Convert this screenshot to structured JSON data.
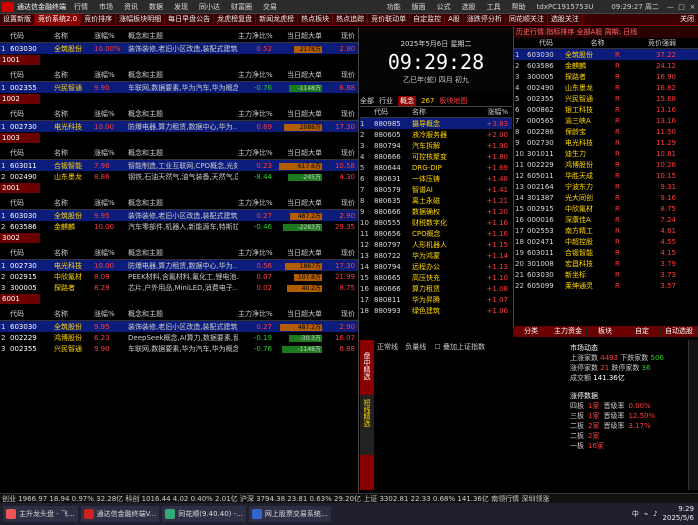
{
  "menubar": {
    "title": "通达信金融终端",
    "items": [
      "行情",
      "市场",
      "资讯",
      "数据",
      "发现",
      "同小达",
      "财富圈",
      "交易"
    ],
    "right_items": [
      "功能",
      "版面",
      "公式",
      "选股",
      "工具",
      "帮助"
    ],
    "account": "tdxPC1915753U",
    "clock": "09:29:27 周二"
  },
  "tabs": [
    "设置新版",
    "竞价系统2.0",
    "竞价排序",
    "涨幅板块明细",
    "每日早盘公告",
    "龙虎榜复盘",
    "新闻龙虎榜",
    "热点板块",
    "热点追踪",
    "竞价联动单",
    "自定监控",
    "A股",
    "涨跌停分析",
    "同花顺关注",
    "选股关注",
    "关闭"
  ],
  "headers": [
    "代码",
    "名称",
    "涨幅%",
    "概念和主题",
    "主力净比%",
    "当日超大单",
    "现价"
  ],
  "sections": [
    {
      "marker": "",
      "count": "",
      "rows": [
        [
          "1",
          "603030",
          "全筑股份",
          "10.00%",
          "装饰装修,老旧小区改造,装配式建筑,人工智能,物联网..",
          "0.52",
          "2178万",
          "2.90"
        ]
      ]
    },
    {
      "marker": "1001",
      "count": "",
      "rows": [
        [
          "1",
          "002355",
          "兴民智通",
          "9.90",
          "车联网,数据要素,华为汽车,华为概念..",
          "-0.76",
          "-1148万",
          "6.88"
        ]
      ]
    },
    {
      "marker": "1002",
      "count": "",
      "rows": [
        [
          "1",
          "002730",
          "电光科技",
          "10.00",
          "防爆电器,算力租赁,数据中心,华为..",
          "0.69",
          "2088万",
          "17.30"
        ]
      ]
    },
    {
      "marker": "1003",
      "count": "",
      "rows": [
        [
          "1",
          "603011",
          "合锻智能",
          "7.96",
          "智能制造,工业互联网,CPO概念,光刻机,工业母机",
          "0.23",
          "617.6万",
          "10.58"
        ],
        [
          "2",
          "002490",
          "山东墨龙",
          "8.86",
          "钢铁,石油天然气,油气装备,天然气,国企改革..",
          "-8.44",
          "-245万",
          "4.30"
        ]
      ]
    },
    {
      "marker": "2001",
      "count": "",
      "rows": [
        [
          "1",
          "603030",
          "全筑股份",
          "9.95",
          "装饰装修,老旧小区改造,装配式建筑,人工智能,物联网..",
          "0.27",
          "487.2万",
          "2.90"
        ],
        [
          "2",
          "603586",
          "金麒麟",
          "10.00",
          "汽车零部件,机器人,新能源车,特斯拉..",
          "-0.46",
          "-2283万",
          "29.35"
        ]
      ]
    },
    {
      "marker": "3002",
      "count": "3",
      "rows": [
        [
          "1",
          "002730",
          "电光科技",
          "10.00",
          "防爆电器,算力租赁,数据中心,华为..",
          "0.56",
          "1867万",
          "17.30"
        ],
        [
          "2",
          "002915",
          "中欣氟材",
          "8.09",
          "PEEK材料,含氟材料,氟化工,锂电池..",
          "0.07",
          "107.8万",
          "21.99"
        ],
        [
          "3",
          "300005",
          "探路者",
          "8.29",
          "芯片,户外用品,MiniLED,消费电子..",
          "0.02",
          "40.2万",
          "8.75"
        ]
      ]
    },
    {
      "marker": "6001",
      "count": "3",
      "rows": [
        [
          "1",
          "603030",
          "全筑股份",
          "9.95",
          "装饰装修,老旧小区改造,装配式建筑,人工智能,物联网..",
          "0.27",
          "487.2万",
          "2.90"
        ],
        [
          "2",
          "002229",
          "鸿博股份",
          "6.23",
          "DeepSeek概念,AI算力,数据要素,智能..",
          "-0.19",
          "-30.3万",
          "16.07"
        ],
        [
          "3",
          "002355",
          "兴民智通",
          "9.90",
          "车联网,数据要素,华为汽车,华为概念..",
          "-0.76",
          "-1148万",
          "6.88"
        ]
      ]
    }
  ],
  "clock": {
    "date": "2025年5月6日 星期二",
    "time": "09:29:28",
    "lunar": "乙巳年(蛇) 四月 初九"
  },
  "concept": {
    "tabs": [
      "全部",
      "行业",
      "概念",
      "267",
      "板块地图"
    ],
    "headers": [
      "代码",
      "名称",
      "涨幅%"
    ],
    "rows": [
      [
        "1",
        "880985",
        "摄导概念",
        "+3.83"
      ],
      [
        "2",
        "880605",
        "液冷服务器",
        "+2.00"
      ],
      [
        "3",
        "880794",
        "汽车拆解",
        "+1.90"
      ],
      [
        "4",
        "880666",
        "可控核聚变",
        "+1.80"
      ],
      [
        "5",
        "880644",
        "DRG-DIP",
        "+1.69"
      ],
      [
        "6",
        "880631",
        "一体压铸",
        "+1.48"
      ],
      [
        "7",
        "880579",
        "智谱AI",
        "+1.41"
      ],
      [
        "8",
        "880635",
        "离土永磁",
        "+1.21"
      ],
      [
        "9",
        "880666",
        "数据确权",
        "+1.20"
      ],
      [
        "10",
        "880555",
        "财税数字化",
        "+1.16"
      ],
      [
        "11",
        "880656",
        "CPO概念",
        "+1.16"
      ],
      [
        "12",
        "880797",
        "人形机器人",
        "+1.15"
      ],
      [
        "13",
        "880722",
        "华为鸿蒙",
        "+1.14"
      ],
      [
        "14",
        "880794",
        "远程办公",
        "+1.13"
      ],
      [
        "15",
        "880665",
        "高压快充",
        "+1.10"
      ],
      [
        "16",
        "880666",
        "算力租赁",
        "+1.08"
      ],
      [
        "17",
        "880811",
        "华为昇腾",
        "+1.07"
      ],
      [
        "18",
        "880993",
        "绿色建筑",
        "+1.06"
      ]
    ]
  },
  "right": {
    "title": "历史行情:指标排序 全部A股 周期: 日线",
    "headers": [
      "代码",
      "名称",
      "竞价强弱"
    ],
    "rows": [
      [
        "1",
        "603030",
        "全筑股份",
        "R",
        "37.22"
      ],
      [
        "2",
        "603586",
        "金麒麟",
        "R",
        "24.12"
      ],
      [
        "3",
        "300005",
        "探路者",
        "R",
        "16.90"
      ],
      [
        "4",
        "002490",
        "山东墨龙",
        "R",
        "16.82"
      ],
      [
        "5",
        "002355",
        "兴民智通",
        "R",
        "15.68"
      ],
      [
        "6",
        "000862",
        "银工科技",
        "R",
        "13.16"
      ],
      [
        "7",
        "000565",
        "渝三峡A",
        "R",
        "13.16"
      ],
      [
        "8",
        "002286",
        "保龄宝",
        "R",
        "11.50"
      ],
      [
        "9",
        "002730",
        "电光科技",
        "R",
        "11.29"
      ],
      [
        "10",
        "301011",
        "迪生力",
        "R",
        "10.81"
      ],
      [
        "11",
        "002229",
        "鸿博股份",
        "R",
        "10.26"
      ],
      [
        "12",
        "605011",
        "华胜天成",
        "R",
        "10.15"
      ],
      [
        "13",
        "002164",
        "宁波东力",
        "R",
        "9.31"
      ],
      [
        "14",
        "301387",
        "光大同创",
        "R",
        "9.16"
      ],
      [
        "15",
        "002915",
        "中欣氟材",
        "R",
        "8.75"
      ],
      [
        "16",
        "000016",
        "深康佳A",
        "R",
        "7.24"
      ],
      [
        "17",
        "002553",
        "南方精工",
        "R",
        "4.61"
      ],
      [
        "18",
        "002471",
        "中超控股",
        "R",
        "4.55"
      ],
      [
        "19",
        "603011",
        "合锻智能",
        "R",
        "4.15"
      ],
      [
        "20",
        "301008",
        "宏昌科技",
        "R",
        "3.79"
      ],
      [
        "21",
        "603030",
        "新坐标",
        "R",
        "3.73"
      ],
      [
        "22",
        "605099",
        "莱绅通灵",
        "R",
        "3.57"
      ]
    ],
    "tabs": [
      "分类",
      "主力资金",
      "板块",
      "自定",
      "自动选股"
    ]
  },
  "strip": {
    "a": "盘中精选",
    "b": "短线精选"
  },
  "chartctl": {
    "a": "正常线",
    "b": "负量线",
    "c": "叠加上证指数"
  },
  "market": {
    "title": "市场动态",
    "up_label": "上涨家数",
    "up": "4493",
    "down_label": "下跌家数",
    "down": "506",
    "limitup_label": "涨停家数",
    "limitup": "21",
    "limitdown_label": "跌停家数",
    "limitdown": "36",
    "volume_label": "成交额",
    "volume": "141.36亿",
    "ladder_title": "涨停数据",
    "ladder": [
      [
        "四板",
        "1家",
        "晋级率",
        "0.00%"
      ],
      [
        "三板",
        "1家",
        "晋级率",
        "12.50%"
      ],
      [
        "二板",
        "2家",
        "晋级率",
        "3.17%"
      ],
      [
        "二板",
        "2家",
        "",
        ""
      ],
      [
        "一板",
        "16家",
        "",
        ""
      ]
    ]
  },
  "ibar": "创业 1966.97  18.94  0.97%  32.28亿  科创 1016.44  4.02  0.40%  2.01亿  沪深 3794.38  23.81  0.63%  29.20亿  上证 3302.81  22.33  0.68%  141.36亿  南领行情  深圳领涨",
  "taskbar": [
    "主升龙头盘 - 飞...",
    "通达信金融终端V...",
    "同花顺(9.40.40) -...",
    "网上股票交易系统..."
  ],
  "tray": {
    "time": "9:29",
    "date": "2025/5/6"
  }
}
